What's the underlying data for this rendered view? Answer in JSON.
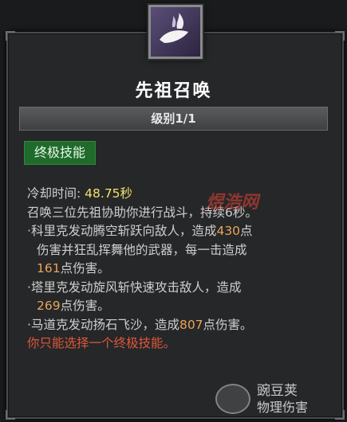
{
  "tooltip": {
    "title": "先祖召唤",
    "level": "级别1/1",
    "category_badge": "终极技能",
    "cooldown_label": "冷却时间:",
    "cooldown_value": "48.75秒",
    "description": "召唤三位先祖协助你进行战斗，持续6秒。",
    "bullets": [
      {
        "pre": "科里克发动腾空斩跃向敌人，造成",
        "value": "430",
        "post": "点",
        "cont_pre": "伤害并狂乱挥舞他的武器，每一击造成",
        "cont2_value": "161",
        "cont2_post": "点伤害。"
      },
      {
        "pre": "塔里克发动旋风斩快速攻击敌人，造成",
        "cont_value": "269",
        "cont_post": "点伤害。"
      },
      {
        "pre": "马道克发动扬石飞沙，造成",
        "value": "807",
        "post": "点伤害。"
      }
    ],
    "note": "你只能选择一个终极技能。"
  },
  "watermarks": {
    "top": "煜浩网",
    "bottom_line1": "豌豆荚",
    "bottom_line2": "物理伤害"
  },
  "colors": {
    "highlight_yellow": "#f2e06b",
    "value_orange": "#e9a45a",
    "note_red": "#e0573b",
    "badge_green": "#1f6b2c"
  },
  "icons": {
    "skill": "ancestral-horn-icon"
  }
}
